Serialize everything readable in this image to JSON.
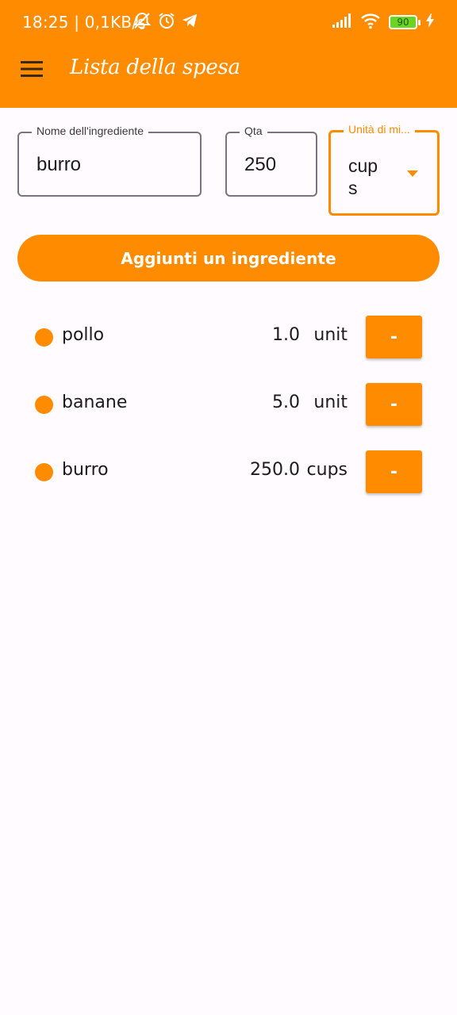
{
  "status_bar": {
    "time_speed": "18:25 | 0,1KB/s",
    "battery_level": "90",
    "icons": [
      "mute-notifications-icon",
      "alarm-icon",
      "telegram-icon",
      "signal-icon",
      "wifi-icon",
      "battery-icon",
      "charging-icon"
    ]
  },
  "app_bar": {
    "title": "Lista della spesa",
    "menu_icon": "menu-icon",
    "color": "#ff8c00"
  },
  "form": {
    "ingredient": {
      "label": "Nome dell'ingrediente",
      "value": "burro"
    },
    "quantity": {
      "label": "Qta",
      "value": "250"
    },
    "unit": {
      "label": "Unità di mi...",
      "value": "cups"
    },
    "add_button": "Aggiunti un ingrediente"
  },
  "items": [
    {
      "name": "pollo",
      "qty": "1.0",
      "unit": "unit",
      "remove_label": "-"
    },
    {
      "name": "banane",
      "qty": "5.0",
      "unit": "unit",
      "remove_label": "-"
    },
    {
      "name": "burro",
      "qty": "250.0",
      "unit": "cups",
      "remove_label": "-"
    }
  ]
}
